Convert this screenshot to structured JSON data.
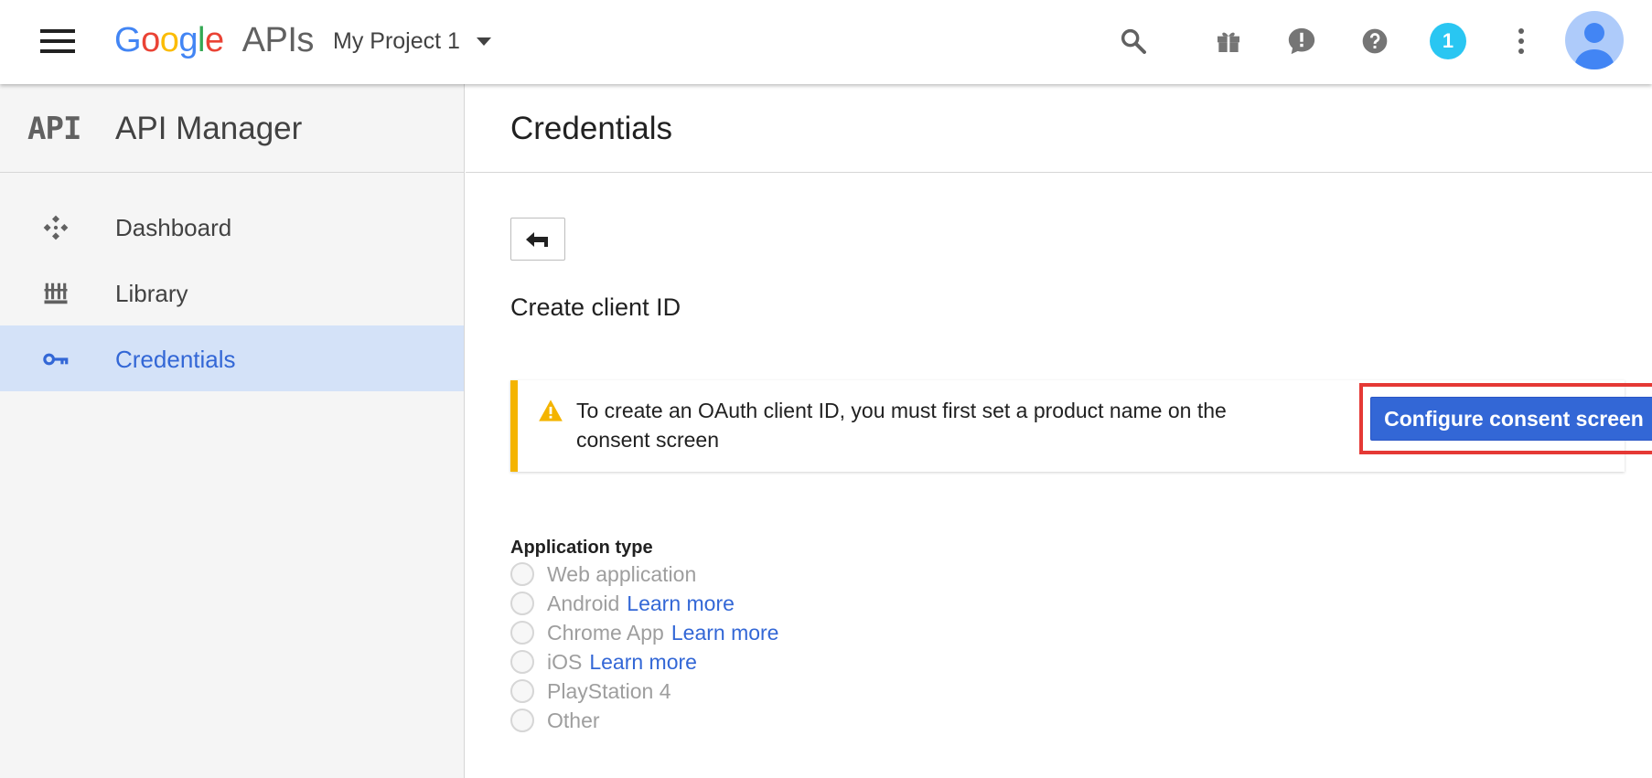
{
  "topbar": {
    "logo_google": [
      "G",
      "o",
      "o",
      "g",
      "l",
      "e"
    ],
    "logo_colors": [
      "#4285f4",
      "#ea4335",
      "#fbbc05",
      "#4285f4",
      "#34a853",
      "#ea4335"
    ],
    "logo_apis": "APIs",
    "project_name": "My Project 1",
    "icons": [
      "search-icon",
      "gift-icon",
      "feedback-icon",
      "help-icon",
      "notifications-icon",
      "more-vert-icon"
    ],
    "notification_count": "1"
  },
  "sidebar": {
    "mark": "API",
    "title": "API Manager",
    "items": [
      {
        "label": "Dashboard",
        "icon": "dashboard-icon",
        "active": false
      },
      {
        "label": "Library",
        "icon": "library-icon",
        "active": false
      },
      {
        "label": "Credentials",
        "icon": "key-icon",
        "active": true
      }
    ]
  },
  "main": {
    "title": "Credentials",
    "subtitle": "Create client ID",
    "notice": {
      "message": "To create an OAuth client ID, you must first set a product name on the consent screen",
      "button": "Configure consent screen"
    },
    "app_type": {
      "label": "Application type",
      "options": [
        {
          "label": "Web application",
          "link": ""
        },
        {
          "label": "Android",
          "link": "Learn more"
        },
        {
          "label": "Chrome App",
          "link": "Learn more"
        },
        {
          "label": "iOS",
          "link": "Learn more"
        },
        {
          "label": "PlayStation 4",
          "link": ""
        },
        {
          "label": "Other",
          "link": ""
        }
      ]
    }
  },
  "colors": {
    "accent": "#3367d6",
    "warning": "#f4b400",
    "highlight_frame": "#e53935",
    "active_nav_bg": "#d4e2f8"
  }
}
